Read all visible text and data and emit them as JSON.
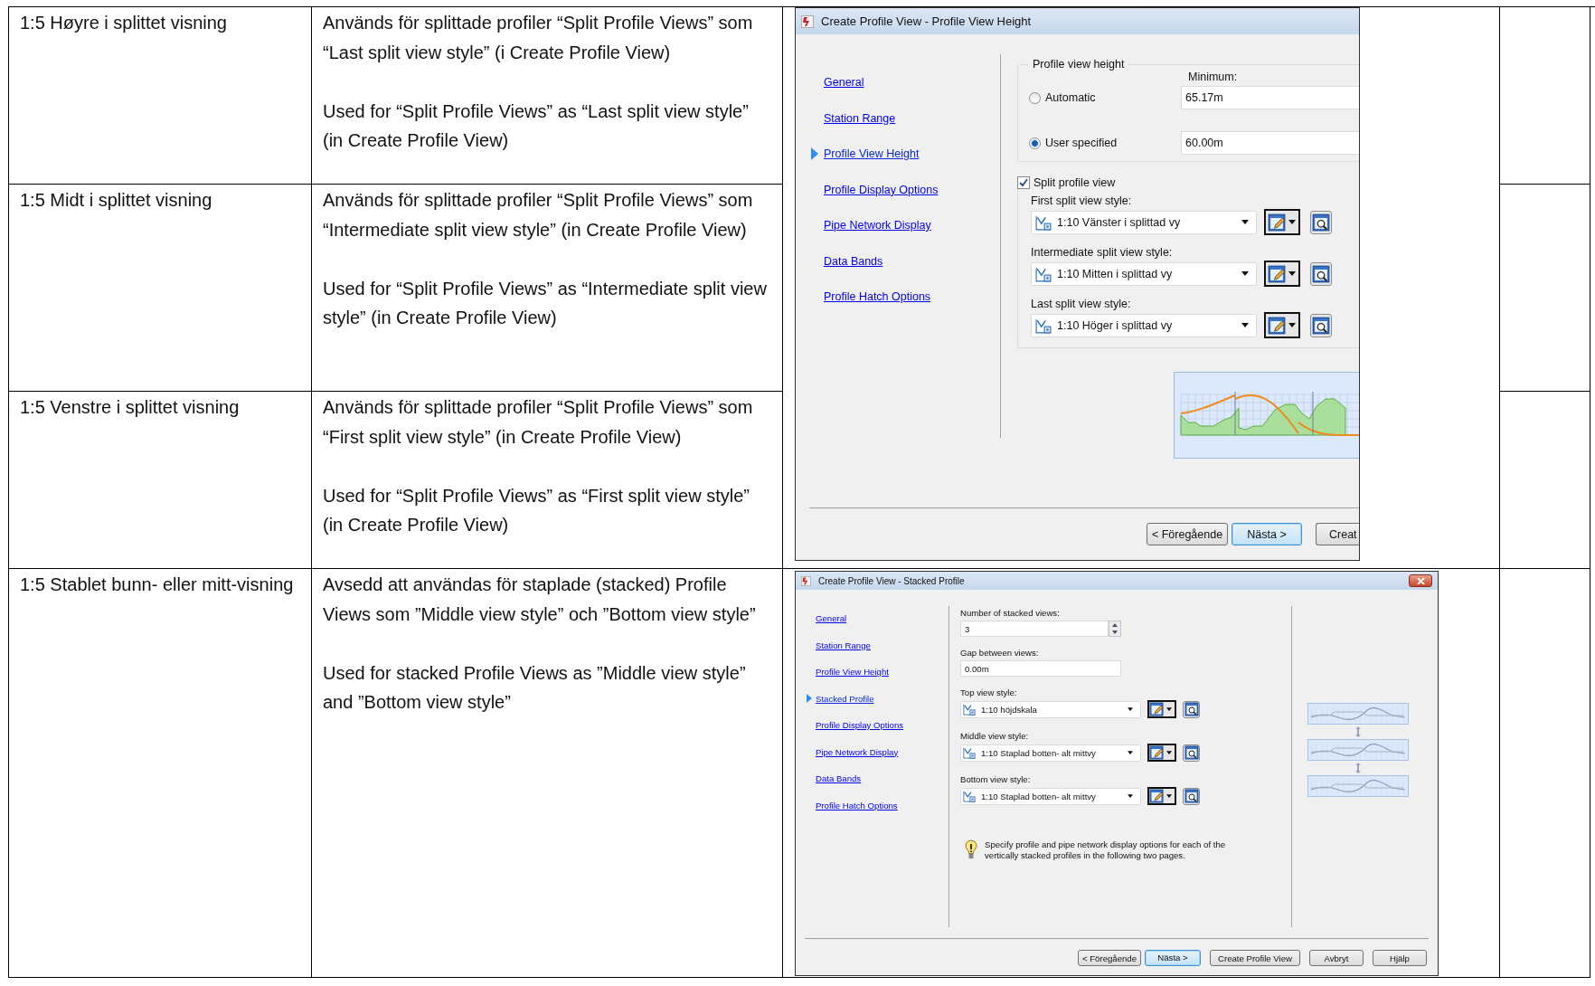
{
  "table": {
    "rows": [
      {
        "name": "1:5 Høyre i splittet visning",
        "description": [
          "Används för splittade profiler “Split Profile Views” som “Last split view style” (i Create Profile View)",
          "Used for “Split Profile Views” as “Last split view style” (in Create Profile View)"
        ]
      },
      {
        "name": "1:5 Midt i splittet visning",
        "description": [
          "Används för splittade profiler “Split Profile Views” som “Intermediate split view style” (in Create Profile View)",
          "Used for “Split Profile Views” as “Intermediate split view style” (in Create Profile View)"
        ]
      },
      {
        "name": "1:5 Venstre i splittet visning",
        "description": [
          "Används för splittade profiler “Split Profile Views” som “First split view style” (in Create Profile View)",
          "Used for “Split Profile Views” as “First split view style” (in Create Profile View)"
        ]
      },
      {
        "name": "1:5 Stablet bunn- eller mitt-visning",
        "description": [
          "Avsedd att användas för staplade (stacked) Profile Views som ”Middle view style” och ”Bottom view style”",
          "Used for stacked Profile Views as ”Middle view style” and ”Bottom view style”"
        ]
      }
    ]
  },
  "split_dialog": {
    "title": "Create Profile View - Profile View Height",
    "nav_items": [
      {
        "label": "General",
        "selected": false
      },
      {
        "label": "Station Range",
        "selected": false
      },
      {
        "label": "Profile View Height",
        "selected": true
      },
      {
        "label": "Profile Display Options",
        "selected": false
      },
      {
        "label": "Pipe Network Display",
        "selected": false
      },
      {
        "label": "Data Bands",
        "selected": false
      },
      {
        "label": "Profile Hatch Options",
        "selected": false
      }
    ],
    "height_group": {
      "title": "Profile view height",
      "minimum_label": "Minimum:",
      "options": [
        {
          "label": "Automatic",
          "selected": false,
          "value": "65.17m"
        },
        {
          "label": "User specified",
          "selected": true,
          "value": "60.00m"
        }
      ]
    },
    "split_profile": {
      "label": "Split profile view",
      "checked": true
    },
    "styles": [
      {
        "label": "First split view style:",
        "value": "1:10 Vänster i splittad vy"
      },
      {
        "label": "Intermediate split view style:",
        "value": "1:10 Mitten i splittad vy"
      },
      {
        "label": "Last split view style:",
        "value": "1:10 Höger i splittad vy"
      }
    ],
    "buttons": [
      {
        "label": "< Föregående",
        "default": false
      },
      {
        "label": "Nästa >",
        "default": true
      },
      {
        "label": "Creat",
        "default": false
      }
    ]
  },
  "stacked_dialog": {
    "title": "Create Profile View - Stacked Profile",
    "nav_items": [
      {
        "label": "General",
        "selected": false
      },
      {
        "label": "Station Range",
        "selected": false
      },
      {
        "label": "Profile View Height",
        "selected": false
      },
      {
        "label": "Stacked Profile",
        "selected": true
      },
      {
        "label": "Profile Display Options",
        "selected": false
      },
      {
        "label": "Pipe Network Display",
        "selected": false
      },
      {
        "label": "Data Bands",
        "selected": false
      },
      {
        "label": "Profile Hatch Options",
        "selected": false
      }
    ],
    "stacked_count": {
      "label": "Number of stacked views:",
      "value": "3"
    },
    "gap": {
      "label": "Gap between views:",
      "value": "0.00m"
    },
    "styles": [
      {
        "label": "Top view style:",
        "value": "1:10 höjdskala"
      },
      {
        "label": "Middle view style:",
        "value": "1:10 Staplad botten- alt mittvy"
      },
      {
        "label": "Bottom view style:",
        "value": "1:10 Staplad botten- alt mittvy"
      }
    ],
    "note": "Specify profile and pipe network display options for each of the vertically stacked profiles in the following two pages.",
    "buttons": [
      {
        "label": "< Föregående",
        "default": false
      },
      {
        "label": "Nästa >",
        "default": true
      },
      {
        "label": "Create Profile View",
        "default": false
      },
      {
        "label": "Avbryt",
        "default": false
      },
      {
        "label": "Hjälp",
        "default": false
      }
    ]
  }
}
